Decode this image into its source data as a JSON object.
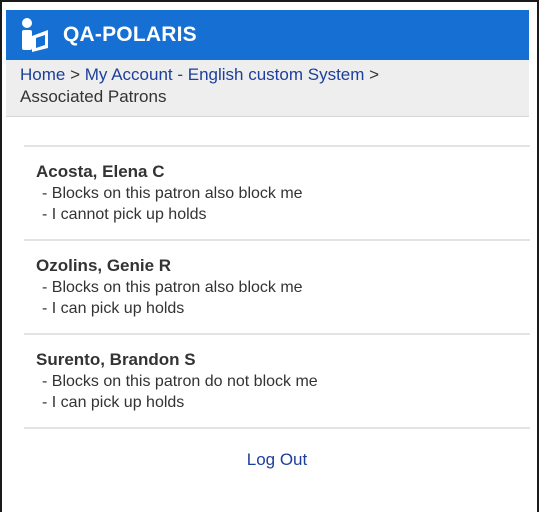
{
  "header": {
    "title": "QA-POLARIS",
    "logo_icon": "library-patron-icon",
    "bg_color": "#1670d4"
  },
  "breadcrumb": {
    "home": "Home",
    "separator": ">",
    "account": "My Account - English custom System",
    "current": "Associated Patrons"
  },
  "patrons": [
    {
      "name": "Acosta, Elena C",
      "line1": "- Blocks on this patron also block me",
      "line2": "- I cannot pick up holds"
    },
    {
      "name": "Ozolins, Genie R",
      "line1": "- Blocks on this patron also block me",
      "line2": "- I can pick up holds"
    },
    {
      "name": "Surento, Brandon S",
      "line1": "- Blocks on this patron do not block me",
      "line2": "- I can pick up holds"
    }
  ],
  "footer": {
    "logout": "Log Out"
  }
}
